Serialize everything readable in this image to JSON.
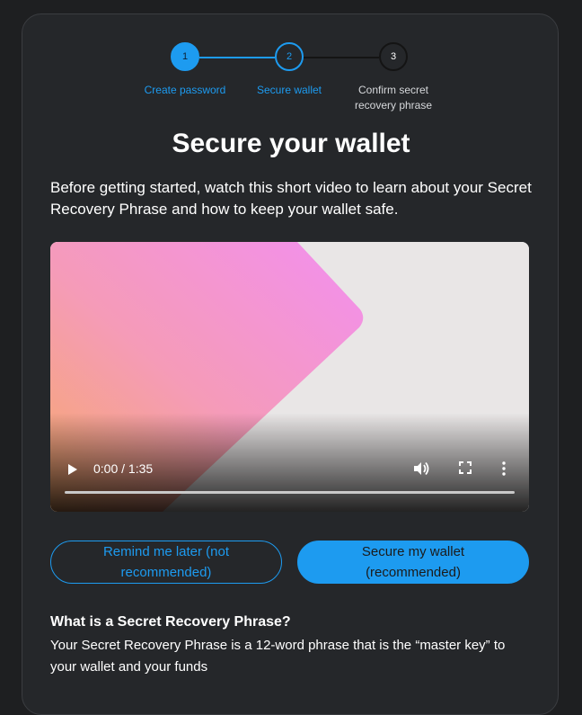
{
  "stepper": {
    "steps": [
      {
        "number": "1",
        "label": "Create password"
      },
      {
        "number": "2",
        "label": "Secure wallet"
      },
      {
        "number": "3",
        "label": "Confirm secret recovery phrase"
      }
    ]
  },
  "page": {
    "title": "Secure your wallet",
    "intro": "Before getting started, watch this short video to learn about your Secret Recovery Phrase and how to keep your wallet safe."
  },
  "video": {
    "time": "0:00 / 1:35",
    "play_icon": "play-icon",
    "volume_icon": "volume-icon",
    "fullscreen_icon": "fullscreen-icon",
    "more_icon": "more-vertical-icon"
  },
  "buttons": {
    "remind_later": "Remind me later (not recommended)",
    "secure_wallet": "Secure my wallet (recommended)"
  },
  "faq": {
    "title": "What is a Secret Recovery Phrase?",
    "body": "Your Secret Recovery Phrase is a 12-word phrase that is the “master key” to your wallet and your funds"
  },
  "colors": {
    "accent": "#1d9bf0",
    "background": "#1e1f21",
    "card": "#25272a"
  }
}
